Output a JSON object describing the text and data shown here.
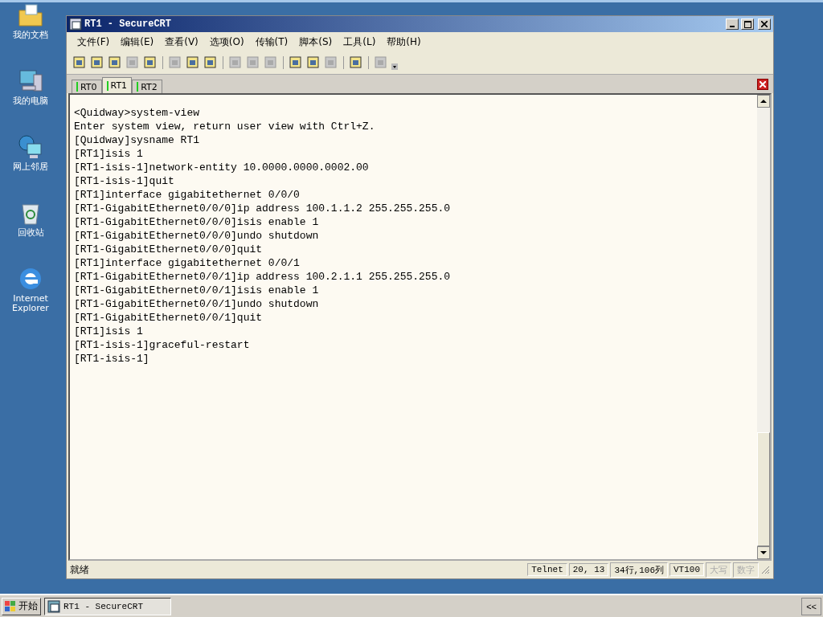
{
  "desktop_icons": [
    {
      "label": "我的文档",
      "kind": "folder"
    },
    {
      "label": "我的电脑",
      "kind": "computer"
    },
    {
      "label": "网上邻居",
      "kind": "network"
    },
    {
      "label": "回收站",
      "kind": "recycle"
    },
    {
      "label": "Internet Explorer",
      "kind": "ie"
    }
  ],
  "window": {
    "title": "RT1 - SecureCRT"
  },
  "menu": [
    "文件(F)",
    "编辑(E)",
    "查看(V)",
    "选项(O)",
    "传输(T)",
    "脚本(S)",
    "工具(L)",
    "帮助(H)"
  ],
  "toolbar": [
    {
      "disabled": false
    },
    {
      "disabled": false
    },
    {
      "disabled": false
    },
    {
      "disabled": true
    },
    {
      "disabled": false
    },
    {
      "disabled": true
    },
    {
      "disabled": false
    },
    {
      "disabled": false
    },
    {
      "disabled": true
    },
    {
      "disabled": true
    },
    {
      "disabled": true
    },
    {
      "disabled": false
    },
    {
      "disabled": false
    },
    {
      "disabled": true
    },
    {
      "disabled": false
    },
    {
      "disabled": true
    }
  ],
  "tabs": [
    {
      "label": "RT0",
      "selected": false
    },
    {
      "label": "RT1",
      "selected": true
    },
    {
      "label": "RT2",
      "selected": false
    }
  ],
  "terminal_lines": [
    "<Quidway>system-view",
    "Enter system view, return user view with Ctrl+Z.",
    "[Quidway]sysname RT1",
    "[RT1]isis 1",
    "[RT1-isis-1]network-entity 10.0000.0000.0002.00",
    "[RT1-isis-1]quit",
    "[RT1]interface gigabitethernet 0/0/0",
    "[RT1-GigabitEthernet0/0/0]ip address 100.1.1.2 255.255.255.0",
    "[RT1-GigabitEthernet0/0/0]isis enable 1",
    "[RT1-GigabitEthernet0/0/0]undo shutdown",
    "[RT1-GigabitEthernet0/0/0]quit",
    "[RT1]interface gigabitethernet 0/0/1",
    "[RT1-GigabitEthernet0/0/1]ip address 100.2.1.1 255.255.255.0",
    "[RT1-GigabitEthernet0/0/1]isis enable 1",
    "[RT1-GigabitEthernet0/0/1]undo shutdown",
    "[RT1-GigabitEthernet0/0/1]quit",
    "[RT1]isis 1",
    "[RT1-isis-1]graceful-restart",
    "[RT1-isis-1]"
  ],
  "status_bar": {
    "message": "就绪",
    "panes": [
      {
        "text": "Telnet",
        "disabled": false
      },
      {
        "text": "20,  13",
        "disabled": false
      },
      {
        "text": "34行,106列",
        "disabled": false
      },
      {
        "text": "VT100",
        "disabled": false
      },
      {
        "text": "大写",
        "disabled": true
      },
      {
        "text": "数字",
        "disabled": true
      }
    ]
  },
  "taskbar": {
    "start": "开始",
    "tasks": [
      {
        "label": "RT1 - SecureCRT",
        "selected": true
      }
    ],
    "tray": "<<"
  }
}
